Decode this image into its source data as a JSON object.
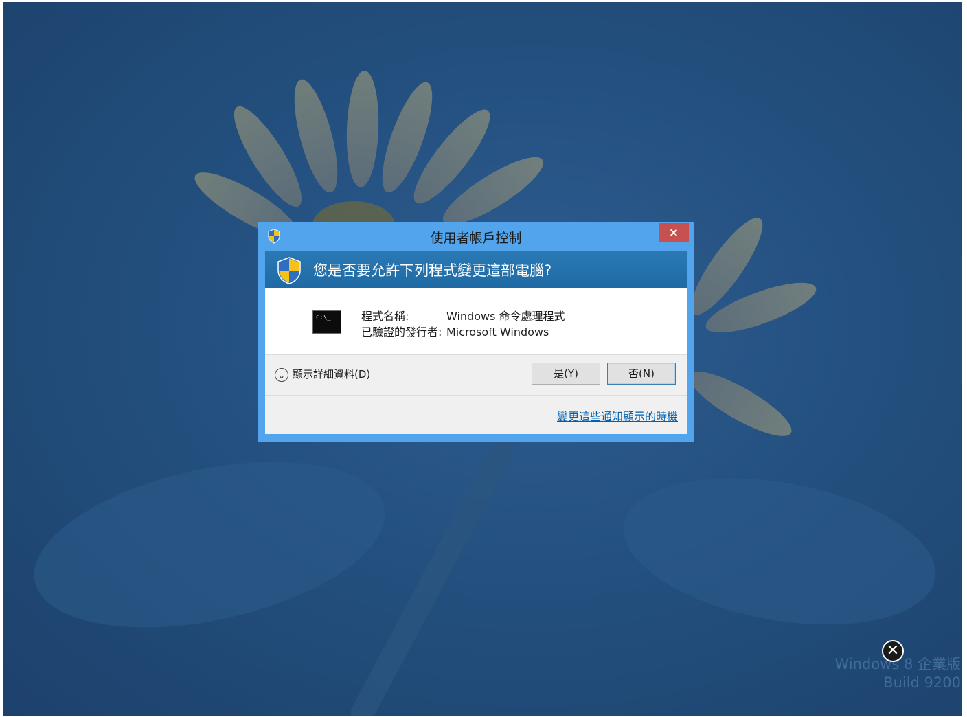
{
  "dialog": {
    "title": "使用者帳戶控制",
    "close_label": "×",
    "question": "您是否要允許下列程式變更這部電腦?",
    "program_name_label": "程式名稱:",
    "program_name": "Windows 命令處理程式",
    "publisher_label": "已驗證的發行者:",
    "publisher": "Microsoft Windows",
    "cmd_icon_text": "C:\\_",
    "show_details": "顯示詳細資料(D)",
    "yes_button": "是(Y)",
    "no_button": "否(N)",
    "change_link": "變更這些通知顯示的時機"
  },
  "watermark": {
    "line1": "Windows 8 企業版",
    "line2": "Build 9200",
    "close_glyph": "✕"
  },
  "colors": {
    "dialog_frame": "#52a4ec",
    "banner": "#1f6aa4",
    "close_button": "#c75050",
    "link": "#0060b0"
  }
}
